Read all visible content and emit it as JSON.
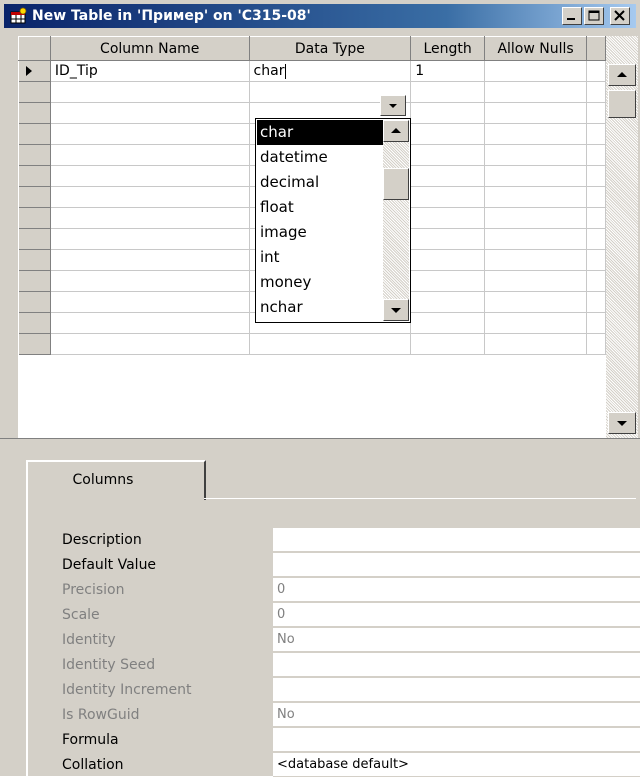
{
  "window": {
    "title": "New Table in 'Пример' on 'C315-08'",
    "buttons": [
      "minimize",
      "maximize",
      "close"
    ]
  },
  "grid": {
    "headers": [
      "Column Name",
      "Data Type",
      "Length",
      "Allow Nulls"
    ],
    "rows": [
      {
        "name": "ID_Tip",
        "type": "char",
        "length": "1",
        "nulls": ""
      }
    ],
    "empty_rows": 12
  },
  "datatype_dropdown": {
    "selected": "char",
    "options": [
      "char",
      "datetime",
      "decimal",
      "float",
      "image",
      "int",
      "money",
      "nchar"
    ]
  },
  "properties": {
    "tab_label": "Columns",
    "rows": [
      {
        "label": "Description",
        "value": "",
        "enabled": true
      },
      {
        "label": "Default Value",
        "value": "",
        "enabled": true
      },
      {
        "label": "Precision",
        "value": "0",
        "enabled": false
      },
      {
        "label": "Scale",
        "value": "0",
        "enabled": false
      },
      {
        "label": "Identity",
        "value": "No",
        "enabled": false
      },
      {
        "label": "Identity Seed",
        "value": "",
        "enabled": false
      },
      {
        "label": "Identity Increment",
        "value": "",
        "enabled": false
      },
      {
        "label": "Is RowGuid",
        "value": "No",
        "enabled": false
      },
      {
        "label": "Formula",
        "value": "",
        "enabled": true
      },
      {
        "label": "Collation",
        "value": "<database default>",
        "enabled": true
      }
    ]
  },
  "colors": {
    "title_start": "#0a246a",
    "title_end": "#a6caf0",
    "face": "#d4d0c8",
    "disabled_text": "#808080",
    "selection": "#000000"
  }
}
